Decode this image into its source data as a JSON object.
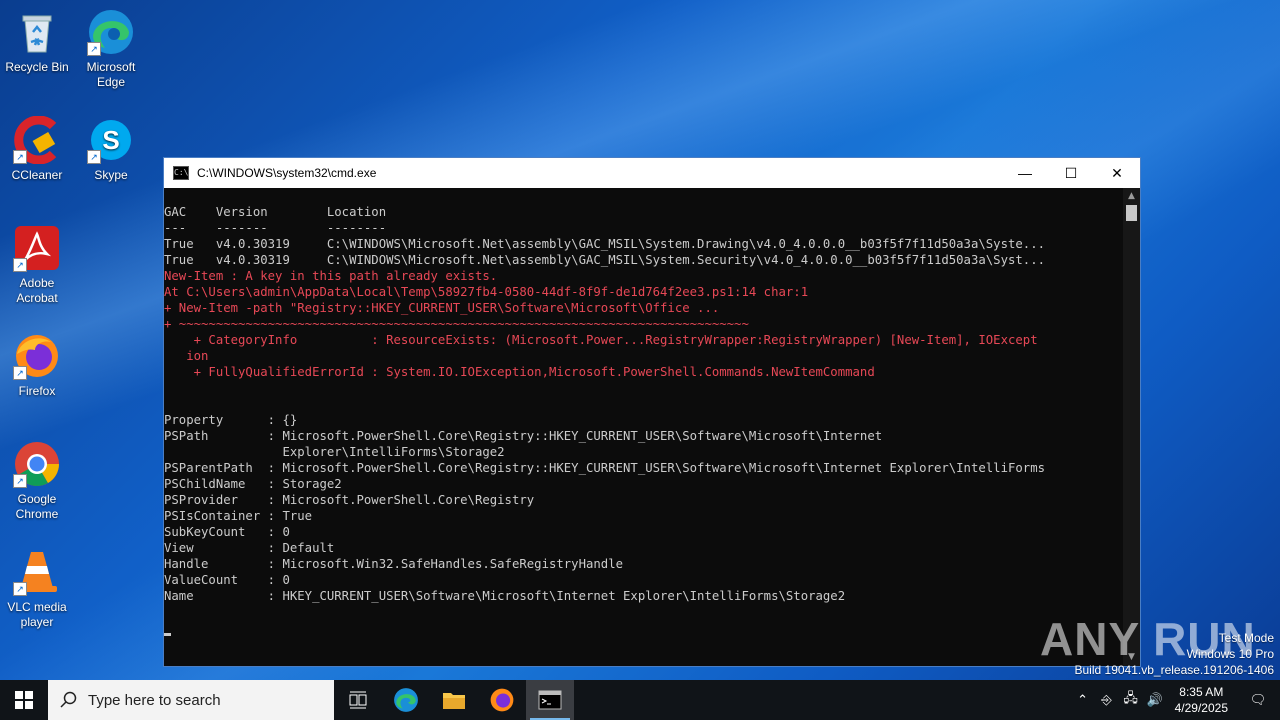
{
  "desktop": {
    "icons": [
      {
        "label": "Recycle Bin"
      },
      {
        "label": "Microsoft Edge"
      },
      {
        "label": "CCleaner"
      },
      {
        "label": "Skype"
      },
      {
        "label": "Adobe Acrobat"
      },
      {
        "label": "Firefox"
      },
      {
        "label": "Google Chrome"
      },
      {
        "label": "VLC media player"
      }
    ]
  },
  "window": {
    "title": "C:\\WINDOWS\\system32\\cmd.exe",
    "controls": {
      "minimize": "—",
      "maximize": "☐",
      "close": "✕"
    }
  },
  "console": {
    "lines": [
      {
        "text": "GAC    Version        Location",
        "type": "normal"
      },
      {
        "text": "---    -------        --------",
        "type": "normal"
      },
      {
        "text": "True   v4.0.30319     C:\\WINDOWS\\Microsoft.Net\\assembly\\GAC_MSIL\\System.Drawing\\v4.0_4.0.0.0__b03f5f7f11d50a3a\\Syste...",
        "type": "normal"
      },
      {
        "text": "True   v4.0.30319     C:\\WINDOWS\\Microsoft.Net\\assembly\\GAC_MSIL\\System.Security\\v4.0_4.0.0.0__b03f5f7f11d50a3a\\Syst...",
        "type": "normal"
      },
      {
        "text": "New-Item : A key in this path already exists.",
        "type": "error"
      },
      {
        "text": "At C:\\Users\\admin\\AppData\\Local\\Temp\\58927fb4-0580-44df-8f9f-de1d764f2ee3.ps1:14 char:1",
        "type": "error"
      },
      {
        "text": "+ New-Item -path \"Registry::HKEY_CURRENT_USER\\Software\\Microsoft\\Office ...",
        "type": "error"
      },
      {
        "text": "+ ~~~~~~~~~~~~~~~~~~~~~~~~~~~~~~~~~~~~~~~~~~~~~~~~~~~~~~~~~~~~~~~~~~~~~~~~~~~~~",
        "type": "error"
      },
      {
        "text": "    + CategoryInfo          : ResourceExists: (Microsoft.Power...RegistryWrapper:RegistryWrapper) [New-Item], IOExcept",
        "type": "error"
      },
      {
        "text": "   ion",
        "type": "error"
      },
      {
        "text": "    + FullyQualifiedErrorId : System.IO.IOException,Microsoft.PowerShell.Commands.NewItemCommand",
        "type": "error"
      },
      {
        "text": "",
        "type": "normal"
      },
      {
        "text": "",
        "type": "normal"
      },
      {
        "text": "Property      : {}",
        "type": "normal"
      },
      {
        "text": "PSPath        : Microsoft.PowerShell.Core\\Registry::HKEY_CURRENT_USER\\Software\\Microsoft\\Internet",
        "type": "normal"
      },
      {
        "text": "                Explorer\\IntelliForms\\Storage2",
        "type": "normal"
      },
      {
        "text": "PSParentPath  : Microsoft.PowerShell.Core\\Registry::HKEY_CURRENT_USER\\Software\\Microsoft\\Internet Explorer\\IntelliForms",
        "type": "normal"
      },
      {
        "text": "PSChildName   : Storage2",
        "type": "normal"
      },
      {
        "text": "PSProvider    : Microsoft.PowerShell.Core\\Registry",
        "type": "normal"
      },
      {
        "text": "PSIsContainer : True",
        "type": "normal"
      },
      {
        "text": "SubKeyCount   : 0",
        "type": "normal"
      },
      {
        "text": "View          : Default",
        "type": "normal"
      },
      {
        "text": "Handle        : Microsoft.Win32.SafeHandles.SafeRegistryHandle",
        "type": "normal"
      },
      {
        "text": "ValueCount    : 0",
        "type": "normal"
      },
      {
        "text": "Name          : HKEY_CURRENT_USER\\Software\\Microsoft\\Internet Explorer\\IntelliForms\\Storage2",
        "type": "normal"
      },
      {
        "text": "",
        "type": "normal"
      }
    ]
  },
  "watermark": {
    "brand": "ANY RUN",
    "test_mode": "Test Mode",
    "edition": "Windows 10 Pro",
    "build": "Build 19041.vb_release.191206-1406"
  },
  "taskbar": {
    "search_placeholder": "Type here to search",
    "clock_time": "8:35 AM",
    "clock_date": "4/29/2025"
  },
  "colors": {
    "console_text": "#cccccc",
    "console_error": "#e74856",
    "console_bg": "#0c0c0c"
  }
}
